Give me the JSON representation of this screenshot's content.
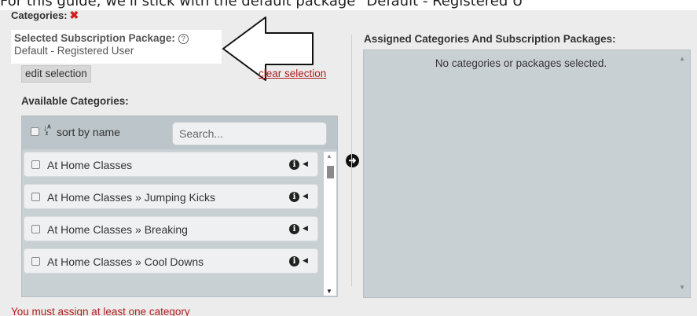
{
  "guide_text": "For this guide, we'll stick with the default package \"Default - Registered U",
  "categories_header": {
    "label": "Categories:",
    "error_mark": "✖"
  },
  "subscription": {
    "title": "Selected Subscription Package:",
    "help_icon": "?",
    "value": "Default - Registered User"
  },
  "edit_selection_label": "edit selection",
  "clear_selection_label": "clear selection",
  "available": {
    "label": "Available Categories:",
    "sort_label": "sort by name",
    "sort_icon": "sort-alpha-icon",
    "search_placeholder": "Search...",
    "items": [
      {
        "label": "At Home Classes"
      },
      {
        "label": "At Home Classes » Jumping Kicks"
      },
      {
        "label": "At Home Classes » Breaking"
      },
      {
        "label": "At Home Classes » Cool Downs"
      }
    ]
  },
  "assigned": {
    "label": "Assigned Categories And Subscription Packages:",
    "empty_message": "No categories or packages selected."
  },
  "error_message": "You must assign at least one category",
  "colors": {
    "panel": "#c9d0d3",
    "error": "#b01c1c",
    "error_mark": "#cc2222"
  }
}
